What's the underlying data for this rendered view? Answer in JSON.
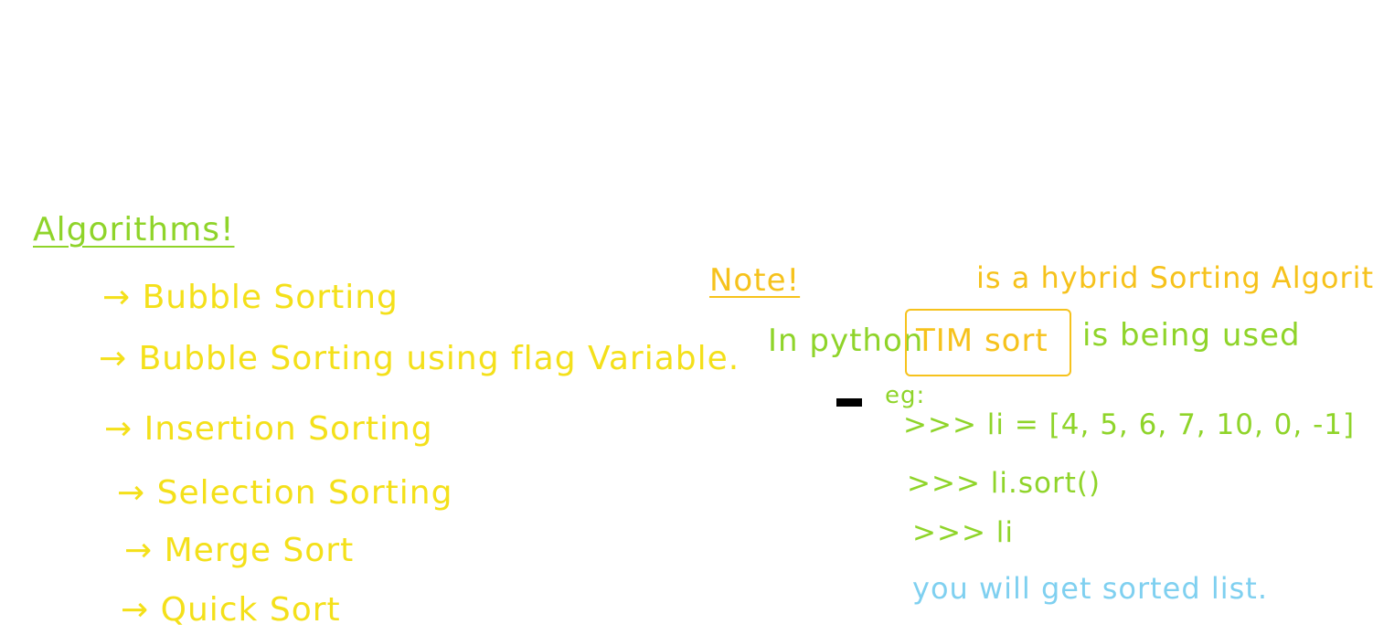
{
  "left": {
    "heading": "Algorithms!",
    "items": [
      "→ Bubble Sorting",
      "→ Bubble Sorting using flag Variable.",
      "→ Insertion Sorting",
      "→ Selection Sorting",
      "→ Merge Sort",
      "→ Quick Sort"
    ]
  },
  "right": {
    "note_label": "Note!",
    "note_rest": "is a hybrid Sorting Algorithm.",
    "python_prefix": "In python",
    "tim_sort": "TIM sort",
    "python_suffix": "is being used",
    "eg_label": "eg:",
    "code": [
      ">>> li = [4, 5, 6, 7, 10, 0, -1]",
      ">>> li.sort()",
      ">>> li"
    ],
    "result": "you will get sorted list."
  },
  "colors": {
    "heading": "#8fd42a",
    "items": "#f4e01a",
    "note": "#f6c21c",
    "python_line": "#8fd42a",
    "code": "#8fd42a",
    "result": "#7fd0f0"
  }
}
